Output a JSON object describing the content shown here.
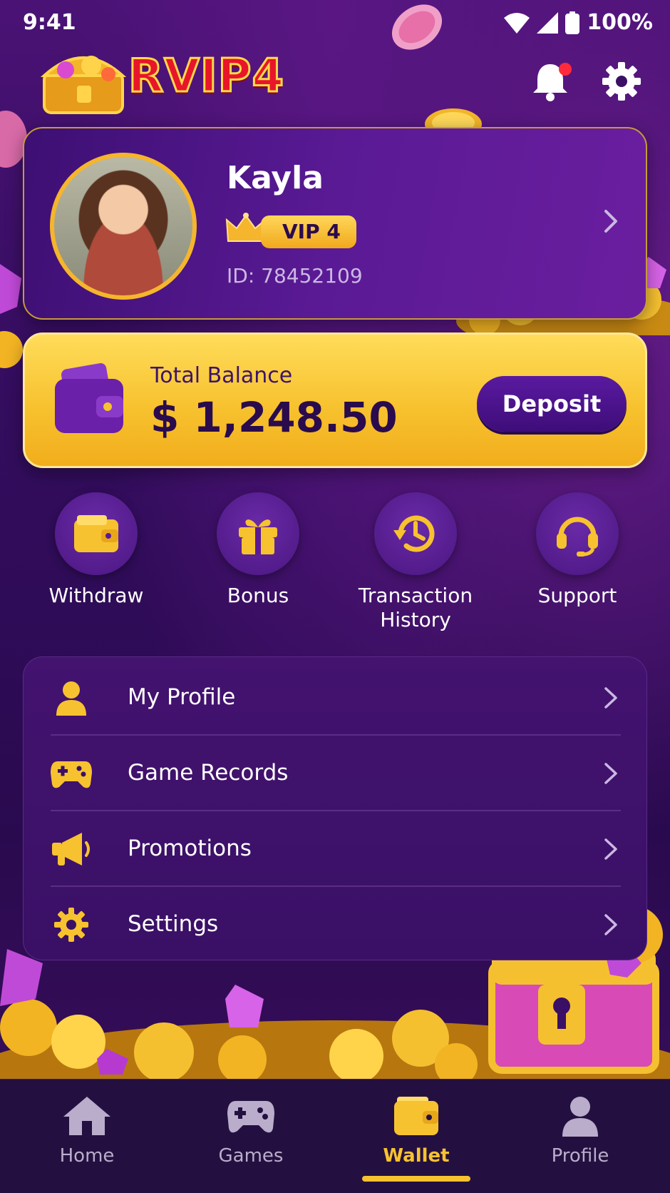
{
  "status_bar": {
    "time": "9:41",
    "battery": "100%"
  },
  "header": {
    "logo_text": "RVIP4"
  },
  "profile": {
    "name": "Kayla",
    "vip": "VIP 4",
    "id": "ID: 78452109"
  },
  "balance": {
    "label": "Total Balance",
    "value": "$ 1,248.50",
    "deposit_label": "Deposit"
  },
  "quick_actions": [
    {
      "label": "Withdraw",
      "icon": "wallet-icon"
    },
    {
      "label": "Bonus",
      "icon": "gift-icon"
    },
    {
      "label": "Transaction History",
      "icon": "history-icon"
    },
    {
      "label": "Support",
      "icon": "headset-icon"
    }
  ],
  "menu": [
    {
      "label": "My Profile",
      "icon": "user-icon"
    },
    {
      "label": "Game Records",
      "icon": "gamepad-icon"
    },
    {
      "label": "Promotions",
      "icon": "megaphone-icon"
    },
    {
      "label": "Settings",
      "icon": "gear-icon"
    }
  ],
  "bottom_nav": [
    {
      "label": "Home",
      "icon": "home-icon",
      "active": false
    },
    {
      "label": "Games",
      "icon": "gamepad-icon",
      "active": false
    },
    {
      "label": "Wallet",
      "icon": "wallet-icon",
      "active": true
    },
    {
      "label": "Profile",
      "icon": "user-icon",
      "active": false
    }
  ],
  "colors": {
    "accent_gold": "#f7c22f",
    "purple_dark": "#2a0b4d",
    "purple_card": "#5a1a95",
    "notification": "#ff2a3c"
  }
}
